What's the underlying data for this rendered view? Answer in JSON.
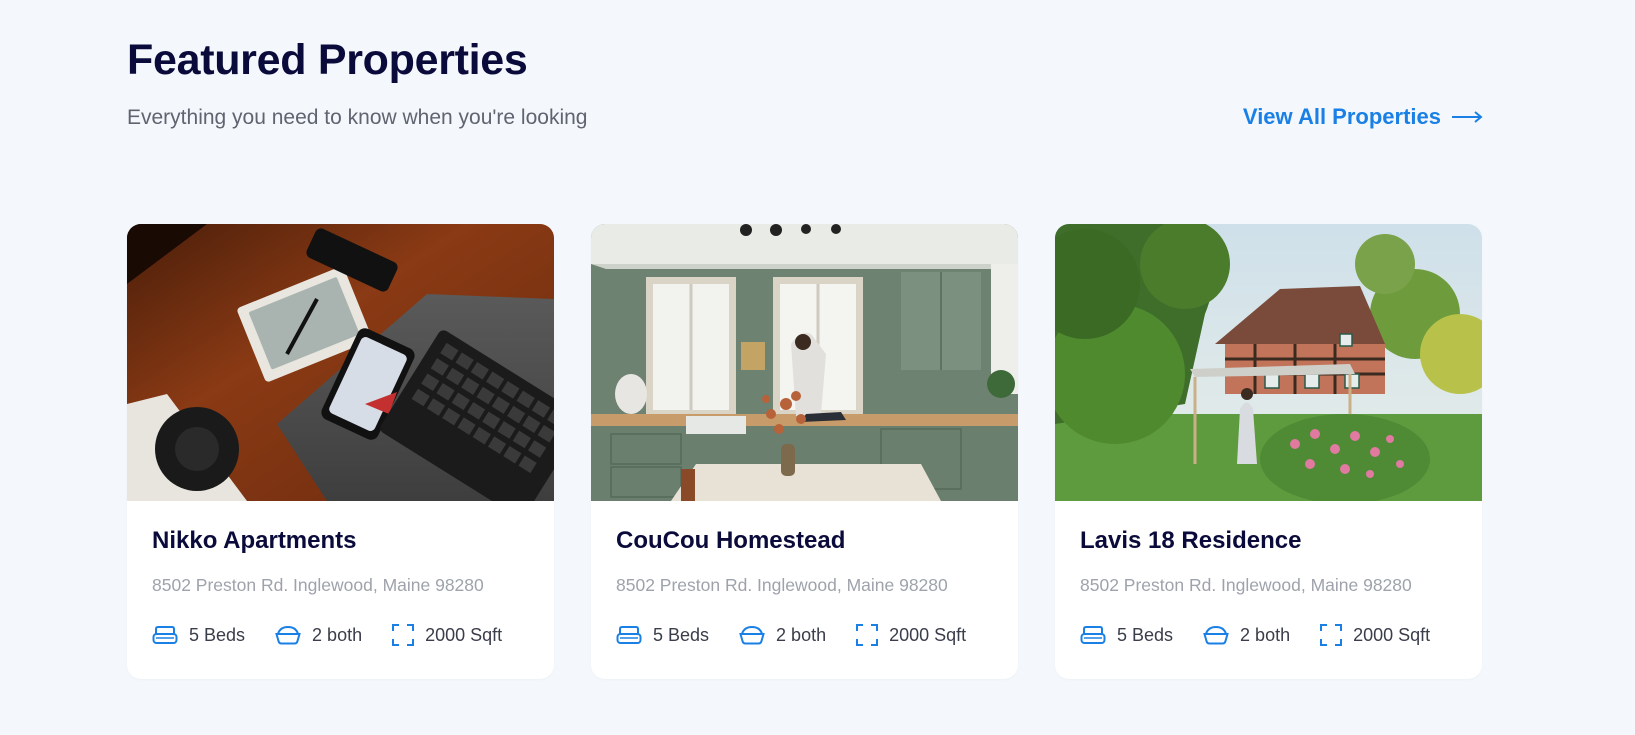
{
  "header": {
    "title": "Featured Properties",
    "subtitle": "Everything you need to know when you're looking",
    "view_all_label": "View All Properties",
    "view_all_icon": "arrow-right-icon"
  },
  "colors": {
    "accent": "#1a80e6",
    "title": "#0b0b3b",
    "muted": "#9ea3ab",
    "background": "#f4f8fc",
    "card": "#ffffff"
  },
  "properties": [
    {
      "image": "desk-workspace-photo",
      "name": "Nikko Apartments",
      "address": "8502 Preston Rd. Inglewood, Maine 98280",
      "beds": "5 Beds",
      "baths": "2 both",
      "area": "2000 Sqft"
    },
    {
      "image": "kitchen-interior-photo",
      "name": "CouCou Homestead",
      "address": "8502 Preston Rd. Inglewood, Maine 98280",
      "beds": "5 Beds",
      "baths": "2 both",
      "area": "2000 Sqft"
    },
    {
      "image": "timber-house-garden-photo",
      "name": "Lavis 18 Residence",
      "address": "8502 Preston Rd. Inglewood, Maine 98280",
      "beds": "5 Beds",
      "baths": "2 both",
      "area": "2000 Sqft"
    }
  ],
  "feature_icons": {
    "beds": "bed-icon",
    "baths": "bathtub-icon",
    "area": "area-frame-icon"
  }
}
